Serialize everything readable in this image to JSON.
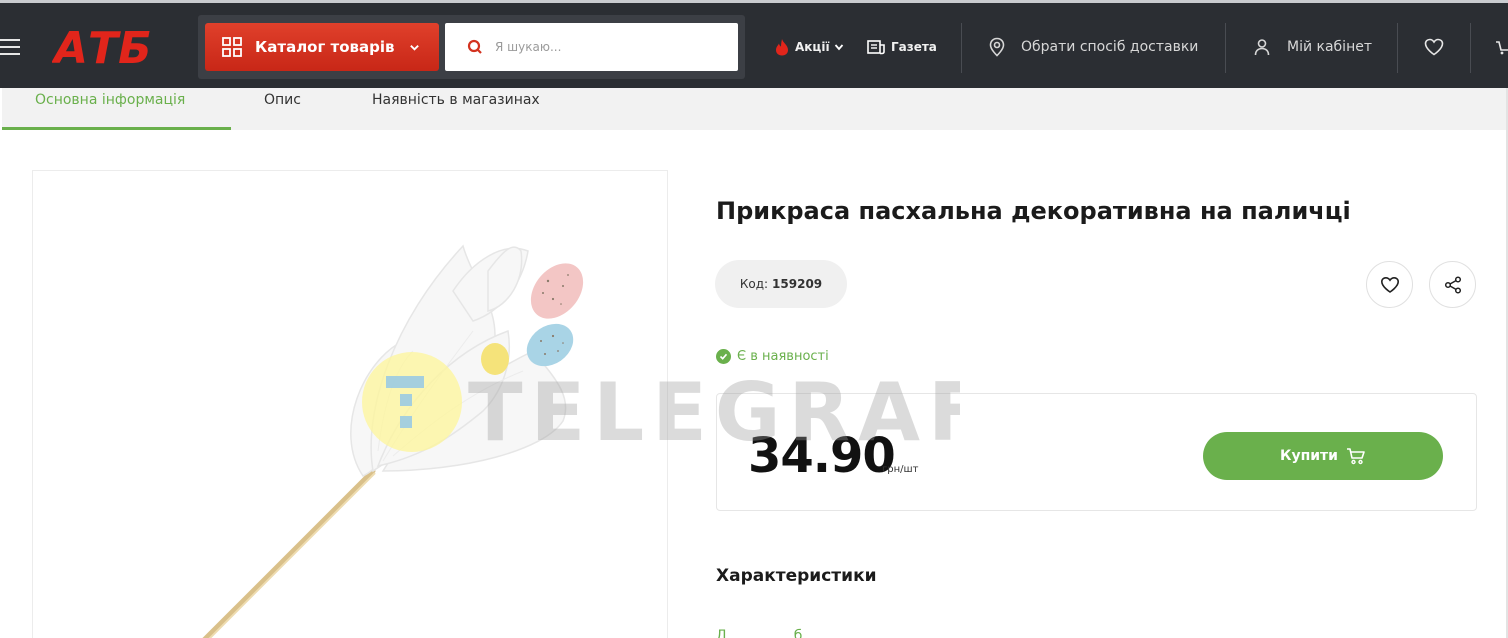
{
  "header": {
    "logo_text": "АТБ",
    "catalog_label": "Каталог товарів",
    "search_placeholder": "Я шукаю...",
    "promo_label": "Акції",
    "newspaper_label": "Газета",
    "delivery_label": "Обрати спосіб доставки",
    "account_label": "Мій кабінет",
    "icons": [
      "menu-icon",
      "grid-icon",
      "chevron-down-icon",
      "search-icon",
      "fire-icon",
      "newspaper-icon",
      "location-pin-icon",
      "user-icon",
      "heart-icon",
      "cart-icon"
    ]
  },
  "tabs": [
    {
      "label": "Основна інформація",
      "active": true
    },
    {
      "label": "Опис",
      "active": false
    },
    {
      "label": "Наявність в магазинах",
      "active": false
    }
  ],
  "product": {
    "title": "Прикраса пасхальна декоративна на паличці",
    "code_label": "Код:",
    "code_value": "159209",
    "availability": "Є в наявності",
    "price": "34.90",
    "price_unit": "грн/шт",
    "buy_label": "Купити",
    "characteristics_title": "Характеристики"
  },
  "watermark": "TELEGRAF",
  "colors": {
    "header_bg": "#2b2e33",
    "catalog_red": "#d3321f",
    "accent_green": "#6ab04c"
  }
}
